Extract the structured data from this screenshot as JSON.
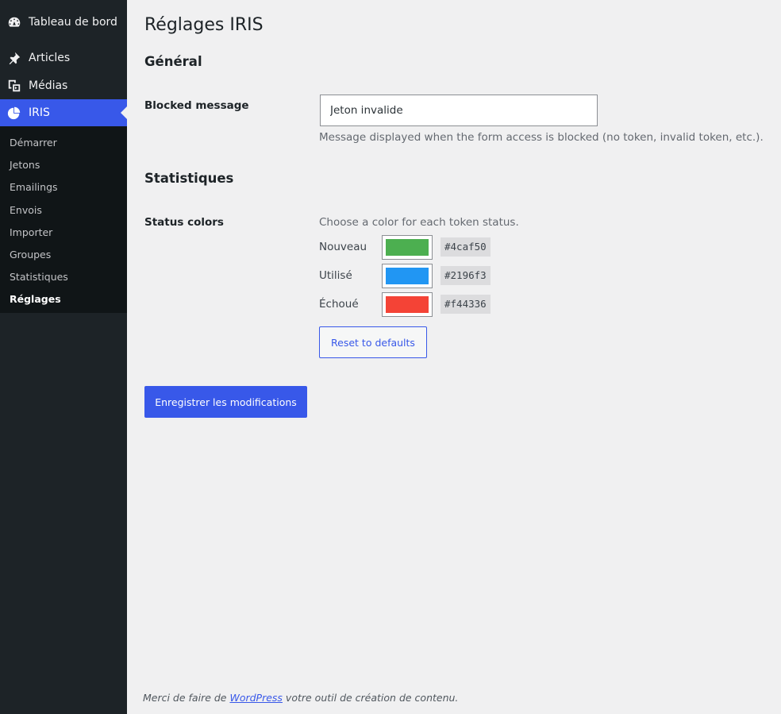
{
  "sidebar": {
    "menu": [
      {
        "label": "Tableau de bord",
        "icon": "dashboard-icon"
      },
      {
        "label": "Articles",
        "icon": "pin-icon"
      },
      {
        "label": "Médias",
        "icon": "media-icon"
      },
      {
        "label": "IRIS",
        "icon": "chart-pie-icon"
      }
    ],
    "submenu": [
      "Démarrer",
      "Jetons",
      "Emailings",
      "Envois",
      "Importer",
      "Groupes",
      "Statistiques",
      "Réglages"
    ]
  },
  "page": {
    "title": "Réglages IRIS"
  },
  "general": {
    "title": "Général",
    "blocked_label": "Blocked message",
    "blocked_value": "Jeton invalide",
    "blocked_desc": "Message displayed when the form access is blocked (no token, invalid token, etc.)."
  },
  "stats": {
    "title": "Statistiques",
    "colors_label": "Status colors",
    "colors_desc": "Choose a color for each token status.",
    "statuses": [
      {
        "label": "Nouveau",
        "color": "#4caf50",
        "hex": "#4caf50"
      },
      {
        "label": "Utilisé",
        "color": "#2196f3",
        "hex": "#2196f3"
      },
      {
        "label": "Échoué",
        "color": "#f44336",
        "hex": "#f44336"
      }
    ],
    "reset_label": "Reset to defaults"
  },
  "actions": {
    "save_label": "Enregistrer les modifications"
  },
  "footer": {
    "before": "Merci de faire de ",
    "link": "WordPress",
    "after": " votre outil de création de contenu."
  },
  "colors": {
    "accent": "#3858e9",
    "sidebar_bg": "#1d2327",
    "submenu_bg": "#101517",
    "page_bg": "#f0f0f1"
  }
}
